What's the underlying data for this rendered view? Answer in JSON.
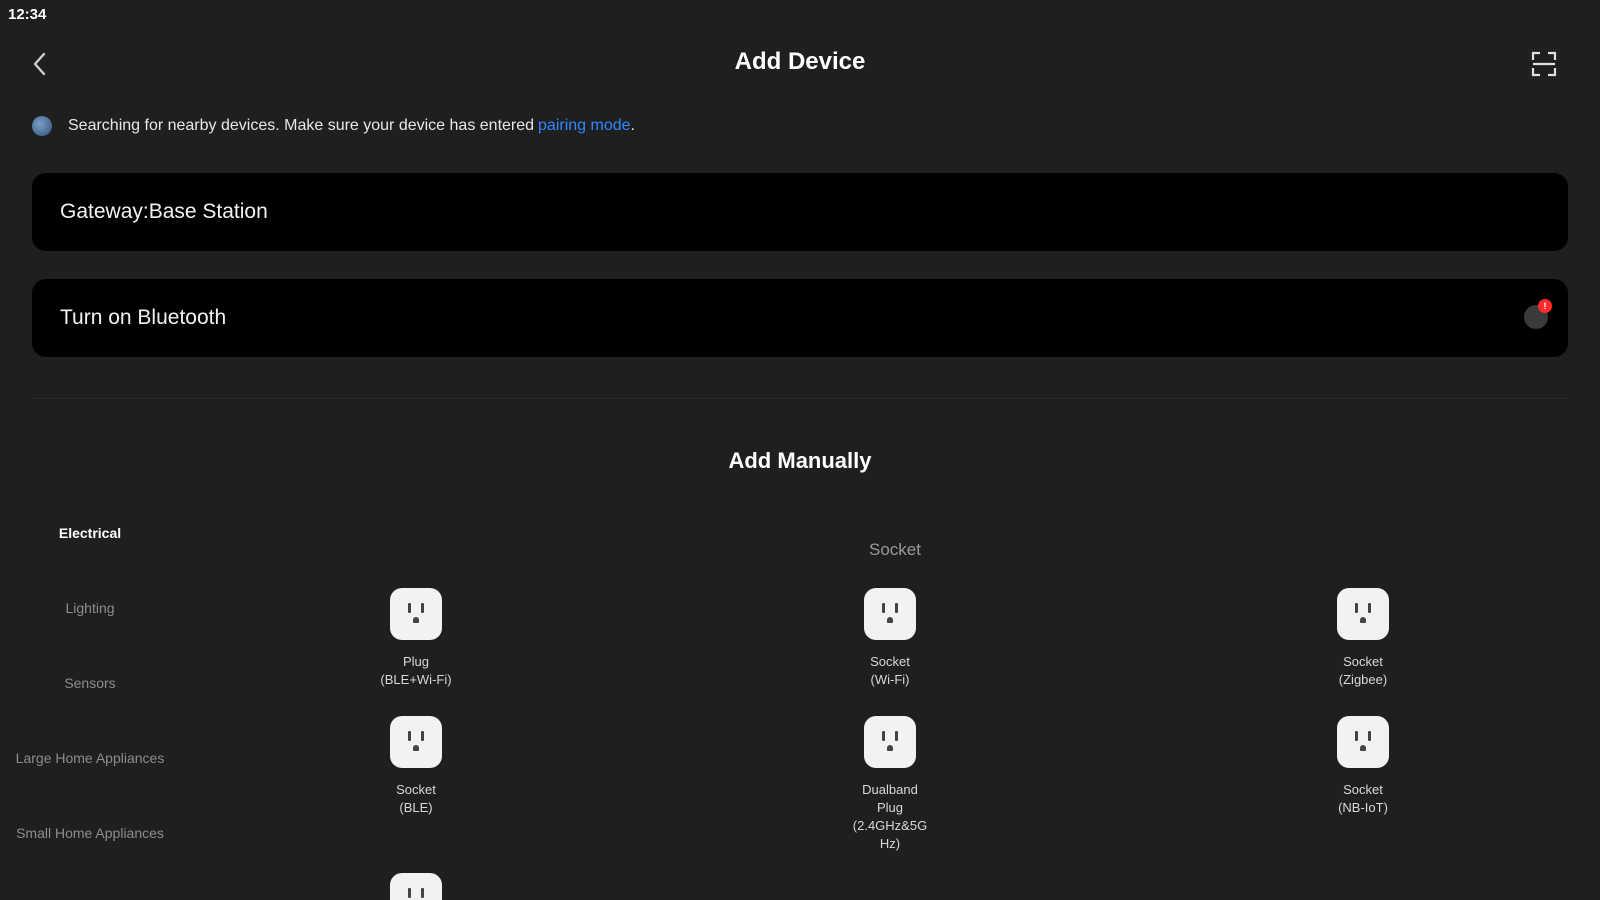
{
  "status_bar": {
    "time": "12:34"
  },
  "header": {
    "title": "Add Device",
    "back_icon": "chevron-left-icon",
    "scan_icon": "scan-icon"
  },
  "search_hint": {
    "text": "Searching for nearby devices. Make sure your device has entered",
    "link": "pairing mode",
    "suffix": "."
  },
  "gateway_card": {
    "label": "Gateway:Base Station"
  },
  "bluetooth_card": {
    "label": "Turn on Bluetooth",
    "badge": "!"
  },
  "manual": {
    "title": "Add Manually"
  },
  "categories": [
    {
      "label": "Electrical",
      "active": true
    },
    {
      "label": "Lighting",
      "active": false
    },
    {
      "label": "Sensors",
      "active": false
    },
    {
      "label": "Large Home Appliances",
      "active": false
    },
    {
      "label": "Small Home Appliances",
      "active": false
    }
  ],
  "subcategory": {
    "title": "Socket"
  },
  "devices": [
    {
      "label": "Plug\n(BLE+Wi-Fi)",
      "icon": "socket-icon"
    },
    {
      "label": "Socket\n(Wi-Fi)",
      "icon": "socket-icon"
    },
    {
      "label": "Socket\n(Zigbee)",
      "icon": "socket-icon"
    },
    {
      "label": "Socket\n(BLE)",
      "icon": "socket-icon"
    },
    {
      "label": "Dualband\nPlug\n(2.4GHz&5G\nHz)",
      "icon": "socket-icon"
    },
    {
      "label": "Socket\n(NB-IoT)",
      "icon": "socket-icon"
    },
    {
      "label": "",
      "icon": "socket-icon"
    }
  ]
}
